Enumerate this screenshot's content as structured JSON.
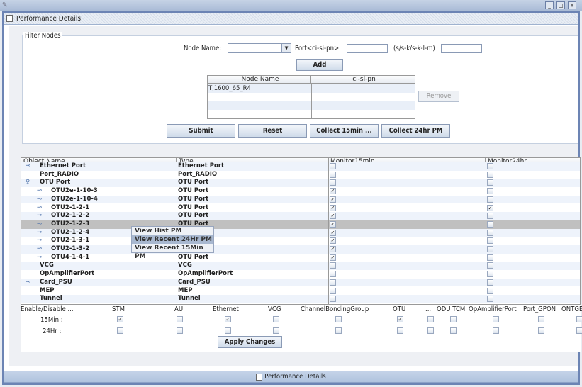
{
  "window": {
    "title": "Performance Details",
    "controls": [
      "minimize",
      "maximize",
      "close"
    ]
  },
  "filter": {
    "legend": "Filter Nodes",
    "node_name_label": "Node Name:",
    "node_name_value": "",
    "port_label": "Port<ci-si-pn>",
    "port_value": "",
    "format_label": "(s/s-k/s-k-l-m)",
    "format_value": "",
    "add_label": "Add",
    "remove_label": "Remove",
    "table": {
      "columns": [
        "Node Name",
        "ci-si-pn"
      ],
      "rows": [
        [
          "TJ1600_65_R4",
          ""
        ]
      ]
    },
    "buttons": {
      "submit": "Submit",
      "reset": "Reset",
      "collect15": "Collect 15min ...",
      "collect24": "Collect 24hr PM"
    }
  },
  "objects": {
    "columns": [
      "Object Name",
      "Type",
      "Monitor15min",
      "Monitor24hr"
    ],
    "rows": [
      {
        "name": "Ethernet Port",
        "type": "Ethernet Port",
        "level": 1,
        "icon": "key-icon",
        "m15": false,
        "m24": false
      },
      {
        "name": "Port_RADIO",
        "type": "Port_RADIO",
        "level": 1,
        "icon": "",
        "m15": false,
        "m24": false
      },
      {
        "name": "OTU Port",
        "type": "OTU Port",
        "level": 1,
        "icon": "expanded-node-icon",
        "m15": false,
        "m24": false
      },
      {
        "name": "OTU2e-1-10-3",
        "type": "OTU Port",
        "level": 2,
        "icon": "key-icon",
        "m15": true,
        "m24": false
      },
      {
        "name": "OTU2e-1-10-4",
        "type": "OTU Port",
        "level": 2,
        "icon": "key-icon",
        "m15": true,
        "m24": false
      },
      {
        "name": "OTU2-1-2-1",
        "type": "OTU Port",
        "level": 2,
        "icon": "key-icon",
        "m15": true,
        "m24": true
      },
      {
        "name": "OTU2-1-2-2",
        "type": "OTU Port",
        "level": 2,
        "icon": "key-icon",
        "m15": true,
        "m24": false
      },
      {
        "name": "OTU2-1-2-3",
        "type": "OTU Port",
        "level": 2,
        "icon": "key-icon",
        "m15": true,
        "m24": false,
        "selected": true
      },
      {
        "name": "OTU2-1-2-4",
        "type": "OTU Port",
        "level": 2,
        "icon": "key-icon",
        "m15": true,
        "m24": false
      },
      {
        "name": "OTU2-1-3-1",
        "type": "OTU Port",
        "level": 2,
        "icon": "key-icon",
        "m15": true,
        "m24": false
      },
      {
        "name": "OTU2-1-3-2",
        "type": "OTU Port",
        "level": 2,
        "icon": "key-icon",
        "m15": true,
        "m24": false
      },
      {
        "name": "OTU4-1-4-1",
        "type": "OTU Port",
        "level": 2,
        "icon": "key-icon",
        "m15": true,
        "m24": false
      },
      {
        "name": "VCG",
        "type": "VCG",
        "level": 1,
        "icon": "",
        "m15": false,
        "m24": false
      },
      {
        "name": "OpAmplifierPort",
        "type": "OpAmplifierPort",
        "level": 1,
        "icon": "",
        "m15": false,
        "m24": false
      },
      {
        "name": "Card_PSU",
        "type": "Card_PSU",
        "level": 1,
        "icon": "key-icon",
        "m15": false,
        "m24": false
      },
      {
        "name": "MEP",
        "type": "MEP",
        "level": 1,
        "icon": "",
        "m15": false,
        "m24": false
      },
      {
        "name": "Tunnel",
        "type": "Tunnel",
        "level": 1,
        "icon": "",
        "m15": false,
        "m24": false
      }
    ]
  },
  "context_menu": {
    "items": [
      "View Hist PM",
      "View Recent 24Hr PM",
      "View Recent 15Min PM"
    ],
    "highlighted": 1
  },
  "enable": {
    "header": "Enable/Disable ...",
    "row_labels": [
      "15Min :",
      "24Hr :"
    ],
    "columns": [
      {
        "label": "STM",
        "m15": true,
        "m24": false
      },
      {
        "label": "AU",
        "m15": false,
        "m24": false
      },
      {
        "label": "Ethernet",
        "m15": true,
        "m24": false
      },
      {
        "label": "VCG",
        "m15": false,
        "m24": false
      },
      {
        "label": "ChannelBondingGroup",
        "m15": false,
        "m24": false
      },
      {
        "label": "OTU",
        "m15": true,
        "m24": false
      },
      {
        "label": "...",
        "m15": false,
        "m24": false
      },
      {
        "label": "ODU TCM",
        "m15": false,
        "m24": false
      },
      {
        "label": "OpAmplifierPort",
        "m15": false,
        "m24": false
      },
      {
        "label": "Port_GPON",
        "m15": false,
        "m24": false
      },
      {
        "label": "ONTGE",
        "m15": false,
        "m24": false
      }
    ],
    "apply_label": "Apply Changes"
  },
  "taskbar": {
    "label": "Performance Details"
  }
}
